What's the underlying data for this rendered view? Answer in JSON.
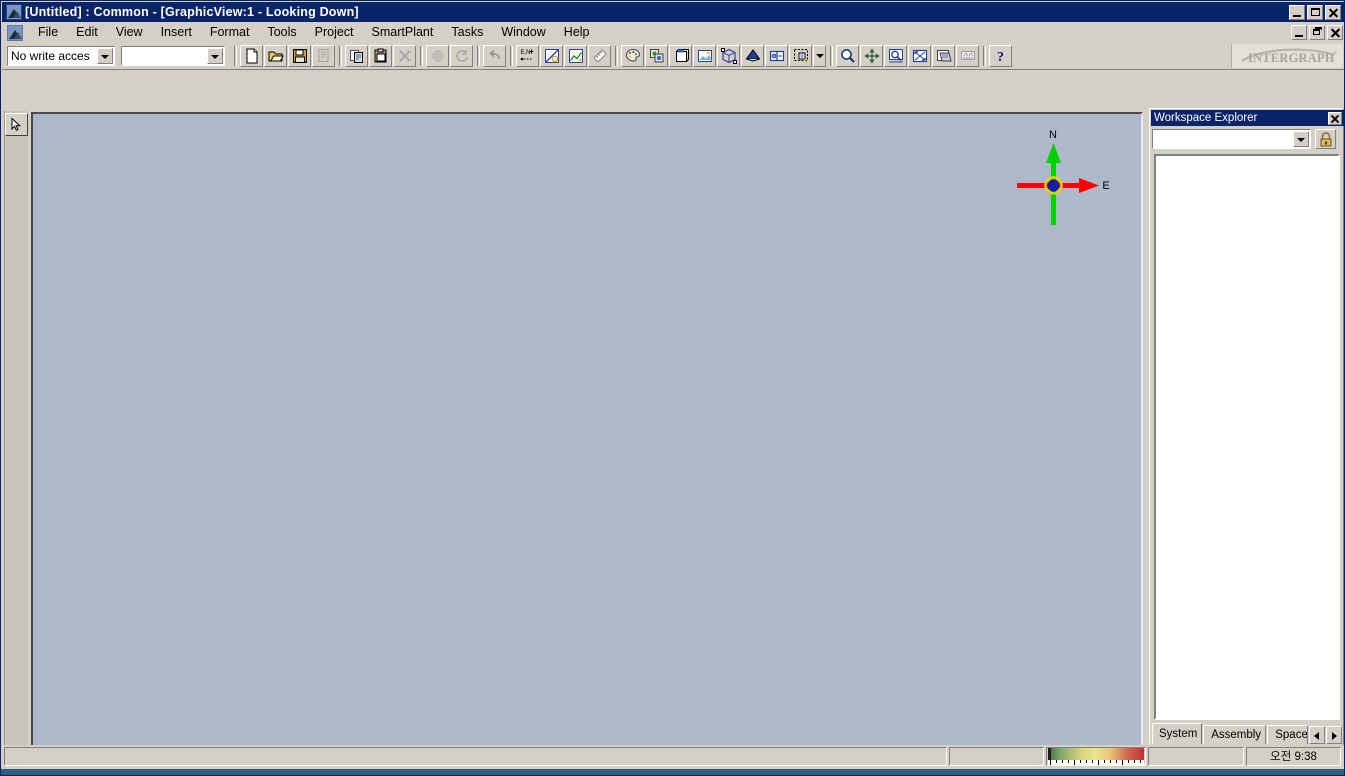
{
  "window": {
    "title": "[Untitled] : Common - [GraphicView:1 - Looking Down]",
    "app_icon": "mountain-logo-icon",
    "controls": {
      "minimize": "minimize-icon",
      "maximize": "maximize-icon",
      "restore": "restore-icon",
      "close": "close-icon"
    }
  },
  "menubar": {
    "icon": "mountain-logo-icon",
    "items": [
      {
        "label": "File"
      },
      {
        "label": "Edit"
      },
      {
        "label": "View"
      },
      {
        "label": "Insert"
      },
      {
        "label": "Format"
      },
      {
        "label": "Tools"
      },
      {
        "label": "Project"
      },
      {
        "label": "SmartPlant"
      },
      {
        "label": "Tasks"
      },
      {
        "label": "Window"
      },
      {
        "label": "Help"
      }
    ]
  },
  "toolbar": {
    "access_combo": {
      "value": "No write acces",
      "placeholder": ""
    },
    "blank_combo": {
      "value": "",
      "placeholder": ""
    },
    "buttons": [
      {
        "name": "new-button",
        "icon": "new-document-icon",
        "enabled": true
      },
      {
        "name": "open-button",
        "icon": "open-folder-icon",
        "enabled": true
      },
      {
        "name": "save-button",
        "icon": "floppy-disk-icon",
        "enabled": true
      },
      {
        "name": "refresh-button",
        "icon": "refresh-icon",
        "enabled": false
      },
      {
        "name": "copy-button",
        "icon": "copy-icon",
        "enabled": true
      },
      {
        "name": "paste-button",
        "icon": "paste-icon",
        "enabled": true
      },
      {
        "name": "delete-button",
        "icon": "delete-x-icon",
        "enabled": false
      },
      {
        "name": "surface-style-button",
        "icon": "diamond-mesh-icon",
        "enabled": false
      },
      {
        "name": "rotate-button",
        "icon": "rotate-arrows-icon",
        "enabled": false
      },
      {
        "name": "undo-button",
        "icon": "undo-arrow-icon",
        "enabled": false
      },
      {
        "name": "coordinate-button",
        "icon": "en-coordinate-icon",
        "enabled": true
      },
      {
        "name": "measure-button",
        "icon": "measure-tool-icon",
        "enabled": true
      },
      {
        "name": "graph-button",
        "icon": "graph-pencil-icon",
        "enabled": true
      },
      {
        "name": "ruler-button",
        "icon": "ruler-icon",
        "enabled": true
      },
      {
        "name": "palette-button",
        "icon": "color-palette-icon",
        "enabled": true
      },
      {
        "name": "copy-objects-button",
        "icon": "copy-objects-icon",
        "enabled": true
      },
      {
        "name": "named-views-button",
        "icon": "named-views-icon",
        "enabled": true
      },
      {
        "name": "view-image-button",
        "icon": "view-image-icon",
        "enabled": true
      },
      {
        "name": "common-views-button",
        "icon": "common-views-cube-icon",
        "enabled": true
      },
      {
        "name": "clip-button",
        "icon": "clipping-plane-icon",
        "enabled": true
      },
      {
        "name": "view-style-button",
        "icon": "view-style-icon",
        "enabled": true
      },
      {
        "name": "fence-button",
        "icon": "fence-select-icon",
        "enabled": true
      },
      {
        "name": "fence-dropdown",
        "icon": "chevron-down-icon",
        "enabled": true
      },
      {
        "name": "zoom-button",
        "icon": "magnifier-icon",
        "enabled": true
      },
      {
        "name": "pan-button",
        "icon": "pan-arrows-icon",
        "enabled": true
      },
      {
        "name": "zoom-area-button",
        "icon": "zoom-area-icon",
        "enabled": true
      },
      {
        "name": "fit-button",
        "icon": "fit-view-icon",
        "enabled": true
      },
      {
        "name": "render-button",
        "icon": "render-shade-icon",
        "enabled": true
      },
      {
        "name": "look-at-button",
        "icon": "look-at-icon",
        "enabled": false
      },
      {
        "name": "help-button",
        "icon": "question-mark-icon",
        "enabled": true
      }
    ],
    "brand": "INTERGRAPH"
  },
  "palette": {
    "buttons": [
      {
        "name": "select-tool",
        "icon": "arrow-cursor-icon",
        "active": true
      }
    ]
  },
  "graphic_view": {
    "background_color": "#adb8ca",
    "compass": {
      "north_label": "N",
      "east_label": "E",
      "north_axis_color": "#00d200",
      "east_axis_color": "#ff0000",
      "center_color": "#1a1aa8",
      "ring_color": "#e8d000"
    }
  },
  "workspace_explorer": {
    "title": "Workspace Explorer",
    "close_icon": "close-icon",
    "filter_combo": {
      "value": "",
      "placeholder": ""
    },
    "lock_icon": "lock-icon",
    "list_items": [],
    "tabs": [
      {
        "label": "System",
        "active": true
      },
      {
        "label": "Assembly",
        "active": false
      },
      {
        "label": "Space",
        "active": false
      }
    ],
    "scroll_left_icon": "arrow-left-icon",
    "scroll_right_icon": "arrow-right-icon"
  },
  "statusbar": {
    "message": "",
    "panel_a": "",
    "meter": {
      "name": "performance-gradient-meter",
      "colors": [
        "#3f6b4a",
        "#cfd07a",
        "#ece48a",
        "#c03030"
      ]
    },
    "panel_b": "",
    "time": "오전 9:38"
  }
}
